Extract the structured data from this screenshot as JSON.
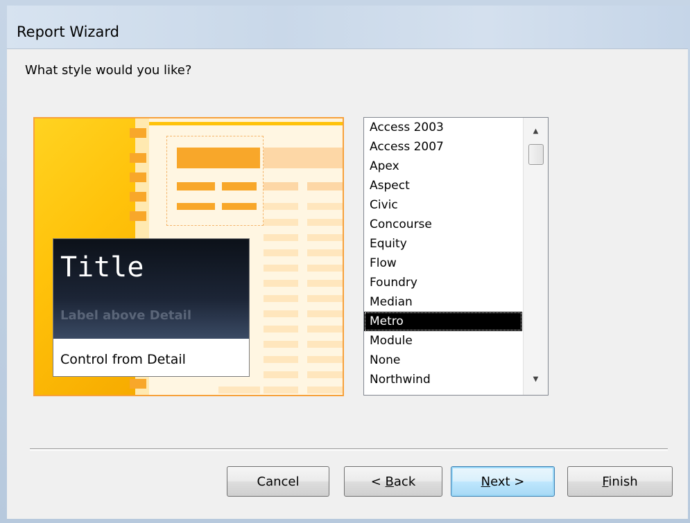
{
  "window": {
    "title": "Report Wizard"
  },
  "prompt": "What style would you like?",
  "preview": {
    "title_sample": "Title",
    "label_sample": "Label above Detail",
    "control_sample": "Control from Detail"
  },
  "styles": {
    "items": [
      "Access 2003",
      "Access 2007",
      "Apex",
      "Aspect",
      "Civic",
      "Concourse",
      "Equity",
      "Flow",
      "Foundry",
      "Median",
      "Metro",
      "Module",
      "None",
      "Northwind"
    ],
    "selected": "Metro"
  },
  "buttons": {
    "cancel": "Cancel",
    "back_prefix": "< ",
    "back_key": "B",
    "back_rest": "ack",
    "next_key": "N",
    "next_rest": "ext >",
    "finish_key": "F",
    "finish_rest": "inish"
  },
  "icons": {
    "scroll_up": "scroll-up-arrow-icon",
    "scroll_down": "scroll-down-arrow-icon"
  },
  "colors": {
    "selection": "#000000",
    "preview_accent": "#f8a72a",
    "default_button": "#3c7fb1"
  }
}
